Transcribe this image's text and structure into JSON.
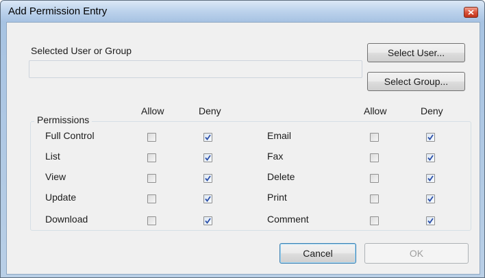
{
  "window": {
    "title": "Add Permission Entry",
    "close_icon": "close-icon"
  },
  "selected": {
    "label": "Selected User or Group",
    "value": ""
  },
  "buttons": {
    "select_user": "Select User...",
    "select_group": "Select Group...",
    "cancel": "Cancel",
    "ok": "OK"
  },
  "permissions": {
    "group_label": "Permissions",
    "allow_header": "Allow",
    "deny_header": "Deny",
    "left": [
      {
        "name": "Full Control",
        "allow": false,
        "deny": true
      },
      {
        "name": "List",
        "allow": false,
        "deny": true
      },
      {
        "name": "View",
        "allow": false,
        "deny": true
      },
      {
        "name": "Update",
        "allow": false,
        "deny": true
      },
      {
        "name": "Download",
        "allow": false,
        "deny": true
      }
    ],
    "right": [
      {
        "name": "Email",
        "allow": false,
        "deny": true
      },
      {
        "name": "Fax",
        "allow": false,
        "deny": true
      },
      {
        "name": "Delete",
        "allow": false,
        "deny": true
      },
      {
        "name": "Print",
        "allow": false,
        "deny": true
      },
      {
        "name": "Comment",
        "allow": false,
        "deny": true
      }
    ]
  },
  "colors": {
    "close_button": "#d9533a",
    "check": "#2b4fa8",
    "title_bar": "#bdd3ec"
  }
}
